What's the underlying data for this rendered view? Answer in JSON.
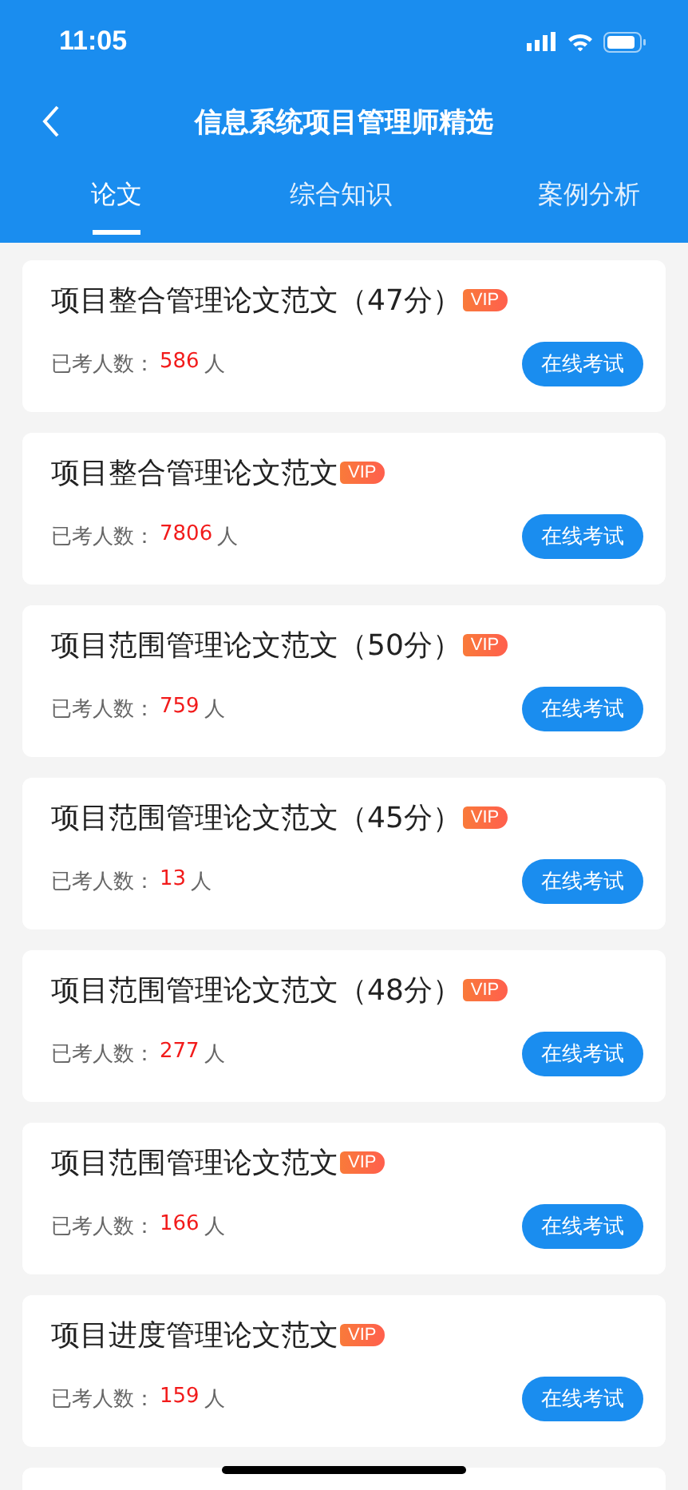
{
  "status_bar": {
    "time": "11:05"
  },
  "nav": {
    "title": "信息系统项目管理师精选"
  },
  "tabs": [
    {
      "label": "论文",
      "selected": true
    },
    {
      "label": "综合知识",
      "selected": false
    },
    {
      "label": "案例分析",
      "selected": false
    }
  ],
  "items": [
    {
      "title": "项目整合管理论文范文（47分）",
      "badge": "VIP",
      "stat_label": "已考人数：",
      "count": "586",
      "unit": "人",
      "button": "在线考试"
    },
    {
      "title": "项目整合管理论文范文",
      "badge": "VIP",
      "stat_label": "已考人数：",
      "count": "7806",
      "unit": "人",
      "button": "在线考试"
    },
    {
      "title": "项目范围管理论文范文（50分）",
      "badge": "VIP",
      "stat_label": "已考人数：",
      "count": "759",
      "unit": "人",
      "button": "在线考试"
    },
    {
      "title": "项目范围管理论文范文（45分）",
      "badge": "VIP",
      "stat_label": "已考人数：",
      "count": "13",
      "unit": "人",
      "button": "在线考试"
    },
    {
      "title": "项目范围管理论文范文（48分）",
      "badge": "VIP",
      "stat_label": "已考人数：",
      "count": "277",
      "unit": "人",
      "button": "在线考试"
    },
    {
      "title": "项目范围管理论文范文",
      "badge": "VIP",
      "stat_label": "已考人数：",
      "count": "166",
      "unit": "人",
      "button": "在线考试"
    },
    {
      "title": "项目进度管理论文范文",
      "badge": "VIP",
      "stat_label": "已考人数：",
      "count": "159",
      "unit": "人",
      "button": "在线考试"
    }
  ]
}
